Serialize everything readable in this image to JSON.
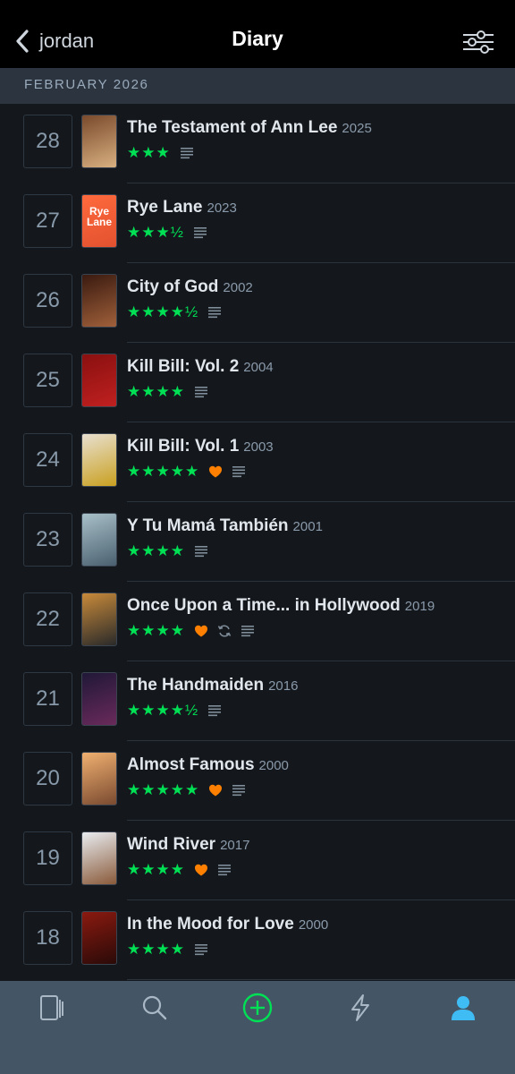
{
  "header": {
    "back_label": "jordan",
    "title": "Diary"
  },
  "month_label": "FEBRUARY 2026",
  "colors": {
    "star_green": "#00e054",
    "heart_orange": "#ff8000",
    "active_tab_blue": "#40bcf4",
    "add_green": "#00e054"
  },
  "entries": [
    {
      "day": "28",
      "title": "The Testament of Ann Lee",
      "year": "2025",
      "stars": "★★★",
      "liked": false,
      "rewatch": false,
      "review": true,
      "poster": [
        "#7a4a2c",
        "#d8b080"
      ],
      "poster_text": ""
    },
    {
      "day": "27",
      "title": "Rye Lane",
      "year": "2023",
      "stars": "★★★½",
      "liked": false,
      "rewatch": false,
      "review": true,
      "poster": [
        "#ff6a3d",
        "#e2512f"
      ],
      "poster_text": "Rye Lane"
    },
    {
      "day": "26",
      "title": "City of God",
      "year": "2002",
      "stars": "★★★★½",
      "liked": false,
      "rewatch": false,
      "review": true,
      "poster": [
        "#3a1a10",
        "#a0603a"
      ],
      "poster_text": ""
    },
    {
      "day": "25",
      "title": "Kill Bill: Vol. 2",
      "year": "2004",
      "stars": "★★★★",
      "liked": false,
      "rewatch": false,
      "review": true,
      "poster": [
        "#8a1010",
        "#c02020"
      ],
      "poster_text": ""
    },
    {
      "day": "24",
      "title": "Kill Bill: Vol. 1",
      "year": "2003",
      "stars": "★★★★★",
      "liked": true,
      "rewatch": false,
      "review": true,
      "poster": [
        "#e8e0d0",
        "#c9a020"
      ],
      "poster_text": ""
    },
    {
      "day": "23",
      "title": "Y Tu Mamá También",
      "year": "2001",
      "stars": "★★★★",
      "liked": false,
      "rewatch": false,
      "review": true,
      "poster": [
        "#a8c0c8",
        "#4a6070"
      ],
      "poster_text": ""
    },
    {
      "day": "22",
      "title": "Once Upon a Time... in Hollywood",
      "year": "2019",
      "stars": "★★★★",
      "liked": true,
      "rewatch": true,
      "review": true,
      "poster": [
        "#c88a3a",
        "#2a2a2a"
      ],
      "poster_text": ""
    },
    {
      "day": "21",
      "title": "The Handmaiden",
      "year": "2016",
      "stars": "★★★★½",
      "liked": false,
      "rewatch": false,
      "review": true,
      "poster": [
        "#201838",
        "#6a2a5a"
      ],
      "poster_text": ""
    },
    {
      "day": "20",
      "title": "Almost Famous",
      "year": "2000",
      "stars": "★★★★★",
      "liked": true,
      "rewatch": false,
      "review": true,
      "poster": [
        "#f0b070",
        "#7a4a30"
      ],
      "poster_text": ""
    },
    {
      "day": "19",
      "title": "Wind River",
      "year": "2017",
      "stars": "★★★★",
      "liked": true,
      "rewatch": false,
      "review": true,
      "poster": [
        "#e8ecf0",
        "#8a5a3a"
      ],
      "poster_text": ""
    },
    {
      "day": "18",
      "title": "In the Mood for Love",
      "year": "2000",
      "stars": "★★★★",
      "liked": false,
      "rewatch": false,
      "review": true,
      "poster": [
        "#8a1a10",
        "#2a0a08"
      ],
      "poster_text": ""
    }
  ],
  "tabs": [
    {
      "icon": "films-icon",
      "active": false
    },
    {
      "icon": "search-icon",
      "active": false
    },
    {
      "icon": "add-icon",
      "active": false
    },
    {
      "icon": "activity-icon",
      "active": false
    },
    {
      "icon": "profile-icon",
      "active": true
    }
  ]
}
